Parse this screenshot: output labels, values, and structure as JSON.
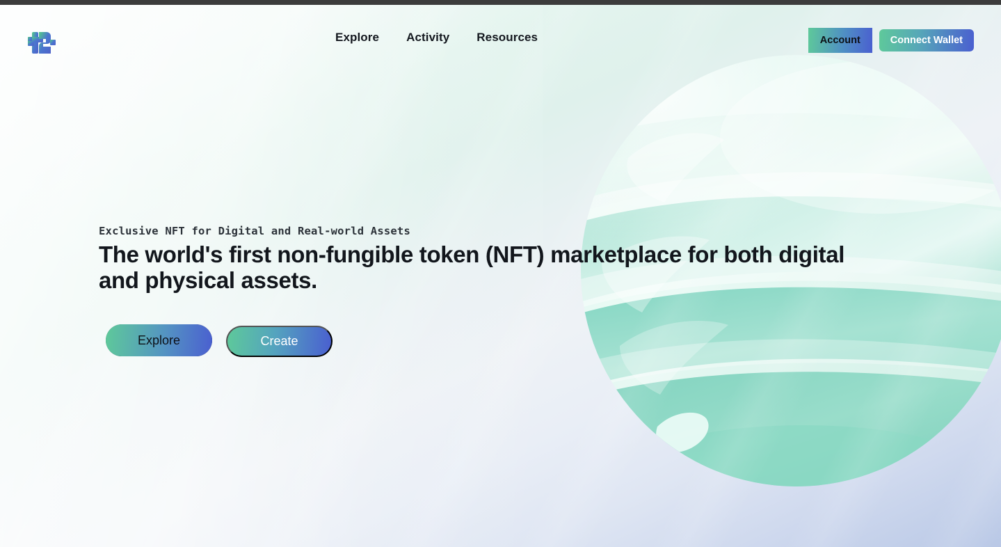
{
  "brand": {
    "logo_icon": "t2-logo-icon",
    "logo_alt": "t2"
  },
  "nav": {
    "items": [
      {
        "label": "Explore"
      },
      {
        "label": "Activity"
      },
      {
        "label": "Resources"
      }
    ]
  },
  "header_actions": {
    "account_label": "Account",
    "connect_wallet_label": "Connect Wallet"
  },
  "hero": {
    "eyebrow": "Exclusive NFT for Digital and Real-world Assets",
    "headline": "The world's first non-fungible token (NFT) marketplace for both digital and physical assets.",
    "primary_cta": "Create",
    "secondary_cta": "Explore",
    "artwork": "twisted-sphere-3d-illustration"
  },
  "colors": {
    "accent_green": "#5ec99a",
    "accent_blue": "#4a5fd0",
    "sphere_mint": "#a8e3d5",
    "sphere_mint_deep": "#7fd4c0",
    "text_dark": "#12161c",
    "background_top_left": "#f7fbfa",
    "background_bottom_right": "#b9c8e6"
  }
}
